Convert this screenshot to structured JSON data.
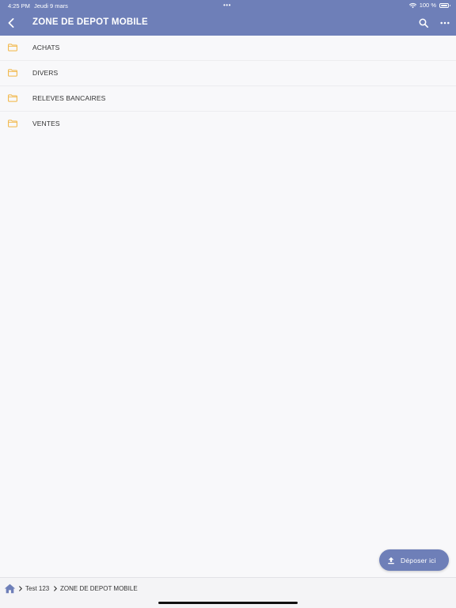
{
  "status_bar": {
    "time": "4:25 PM",
    "date": "Jeudi 9 mars",
    "dots": "•••",
    "battery": "100 %"
  },
  "header": {
    "title": "ZONE DE DEPOT MOBILE",
    "icons": {
      "back": "chevron-left-icon",
      "search": "search-icon",
      "more": "more-horizontal-icon"
    }
  },
  "folders": [
    {
      "label": "ACHATS",
      "icon": "folder-icon"
    },
    {
      "label": "DIVERS",
      "icon": "folder-icon"
    },
    {
      "label": "RELEVES BANCAIRES",
      "icon": "folder-icon"
    },
    {
      "label": "VENTES",
      "icon": "folder-icon"
    }
  ],
  "upload_button": {
    "label": "Déposer ici",
    "icon": "upload-icon"
  },
  "breadcrumb": {
    "home_icon": "home-icon",
    "items": [
      "Test 123",
      "ZONE DE DEPOT MOBILE"
    ]
  },
  "colors": {
    "header_bg": "#6e7fb8",
    "folder_icon": "#f2b542",
    "page_bg": "#f8f8fa",
    "text": "#333333"
  }
}
